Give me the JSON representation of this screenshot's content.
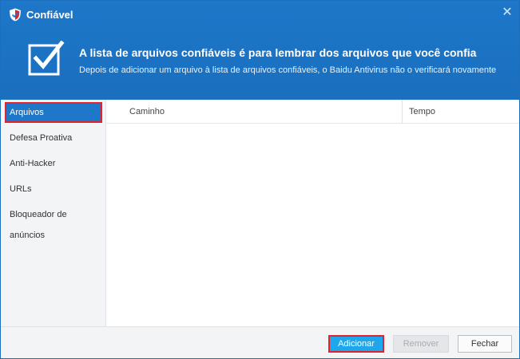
{
  "window": {
    "title": "Confiável",
    "close_glyph": "✕"
  },
  "banner": {
    "headline": "A lista de arquivos confiáveis é para lembrar dos arquivos que você confia",
    "subline": "Depois de adicionar um arquivo à lista de arquivos confiáveis, o Baidu Antivirus não o verificará novamente"
  },
  "sidebar": {
    "items": [
      {
        "label": "Arquivos",
        "active": true
      },
      {
        "label": "Defesa Proativa",
        "active": false
      },
      {
        "label": "Anti-Hacker",
        "active": false
      },
      {
        "label": "URLs",
        "active": false
      },
      {
        "label": "Bloqueador de anúncios",
        "active": false
      }
    ]
  },
  "table": {
    "columns": [
      "Caminho",
      "Tempo"
    ],
    "rows": []
  },
  "footer": {
    "add_label": "Adicionar",
    "remove_label": "Remover",
    "close_label": "Fechar"
  },
  "colors": {
    "header_blue": "#1e77c9",
    "highlight_red": "#e0232f",
    "add_button": "#1ea7ec"
  }
}
